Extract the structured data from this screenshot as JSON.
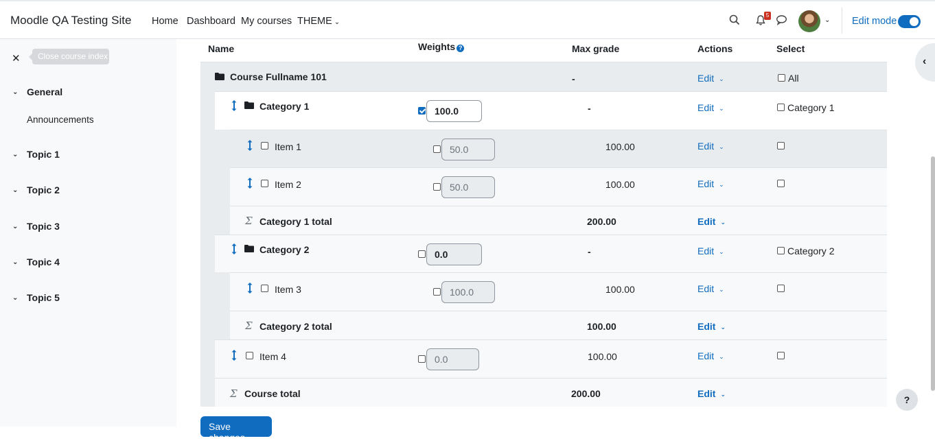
{
  "navbar": {
    "brand": "Moodle QA Testing Site",
    "links": [
      "Home",
      "Dashboard",
      "My courses",
      "THEME"
    ],
    "notification_count": "5",
    "edit_mode_label": "Edit mode",
    "edit_mode_on": true
  },
  "drawer": {
    "close_tooltip": "Close course index",
    "sections": [
      {
        "label": "General",
        "items": [
          "Announcements"
        ]
      },
      {
        "label": "Topic 1"
      },
      {
        "label": "Topic 2"
      },
      {
        "label": "Topic 3"
      },
      {
        "label": "Topic 4"
      },
      {
        "label": "Topic 5"
      }
    ]
  },
  "table": {
    "headers": {
      "name": "Name",
      "weights": "Weights",
      "max_grade": "Max grade",
      "actions": "Actions",
      "select": "Select"
    },
    "edit_label": "Edit",
    "rows": {
      "course": {
        "name": "Course Fullname 101",
        "max": "-",
        "select": "All"
      },
      "cat1": {
        "name": "Category 1",
        "weight": "100.0",
        "max": "-",
        "select": "Category 1"
      },
      "item1": {
        "name": "Item 1",
        "weight": "50.0",
        "max": "100.00"
      },
      "item2": {
        "name": "Item 2",
        "weight": "50.0",
        "max": "100.00"
      },
      "cat1total": {
        "name": "Category 1 total",
        "max": "200.00"
      },
      "cat2": {
        "name": "Category 2",
        "weight": "0.0",
        "max": "-",
        "select": "Category 2"
      },
      "item3": {
        "name": "Item 3",
        "weight": "100.0",
        "max": "100.00"
      },
      "cat2total": {
        "name": "Category 2 total",
        "max": "100.00"
      },
      "item4": {
        "name": "Item 4",
        "weight": "0.0",
        "max": "100.00"
      },
      "coursetotal": {
        "name": "Course total",
        "max": "200.00"
      }
    }
  },
  "save_button": "Save changes",
  "help_button": "?",
  "colors": {
    "primary": "#0f6cbf",
    "badge": "#ca3120"
  }
}
